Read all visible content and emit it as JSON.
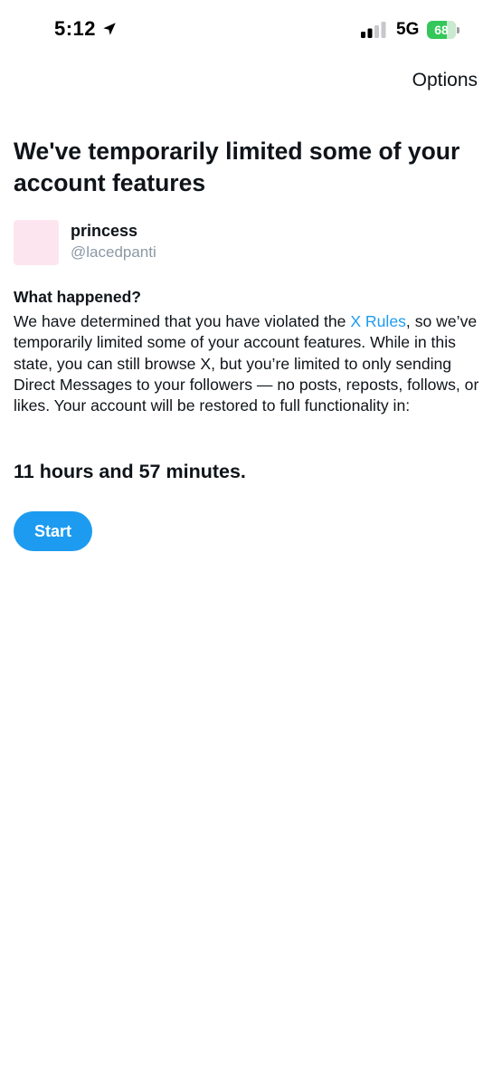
{
  "status_bar": {
    "time": "5:12",
    "location_icon": "location-arrow-icon",
    "signal_icon": "cellular-signal-icon",
    "signal_bars_active": 2,
    "signal_bars_total": 4,
    "network": "5G",
    "battery_percent": "68",
    "battery_level": 0.68,
    "battery_color": "#34c759"
  },
  "header": {
    "options_label": "Options"
  },
  "main": {
    "title": "We've temporarily limited some of your account features",
    "account": {
      "display_name": "princess",
      "handle": "@lacedpanti",
      "avatar_color": "#fde5ef"
    },
    "section_heading": "What happened?",
    "body_before_link": "We have determined that you have violated the ",
    "rules_link": "X Rules",
    "body_after_link": ", so we’ve temporarily limited some of your account features. While in this state, you can still browse X, but you’re limited to only sending Direct Messages to your followers — no posts, reposts, follows, or likes. Your account will be restored to full functionality in:",
    "countdown": "11 hours and 57 minutes.",
    "start_label": "Start"
  },
  "colors": {
    "accent": "#1d9bf0",
    "text": "#0f1419",
    "secondary_text": "#8b98a5"
  }
}
